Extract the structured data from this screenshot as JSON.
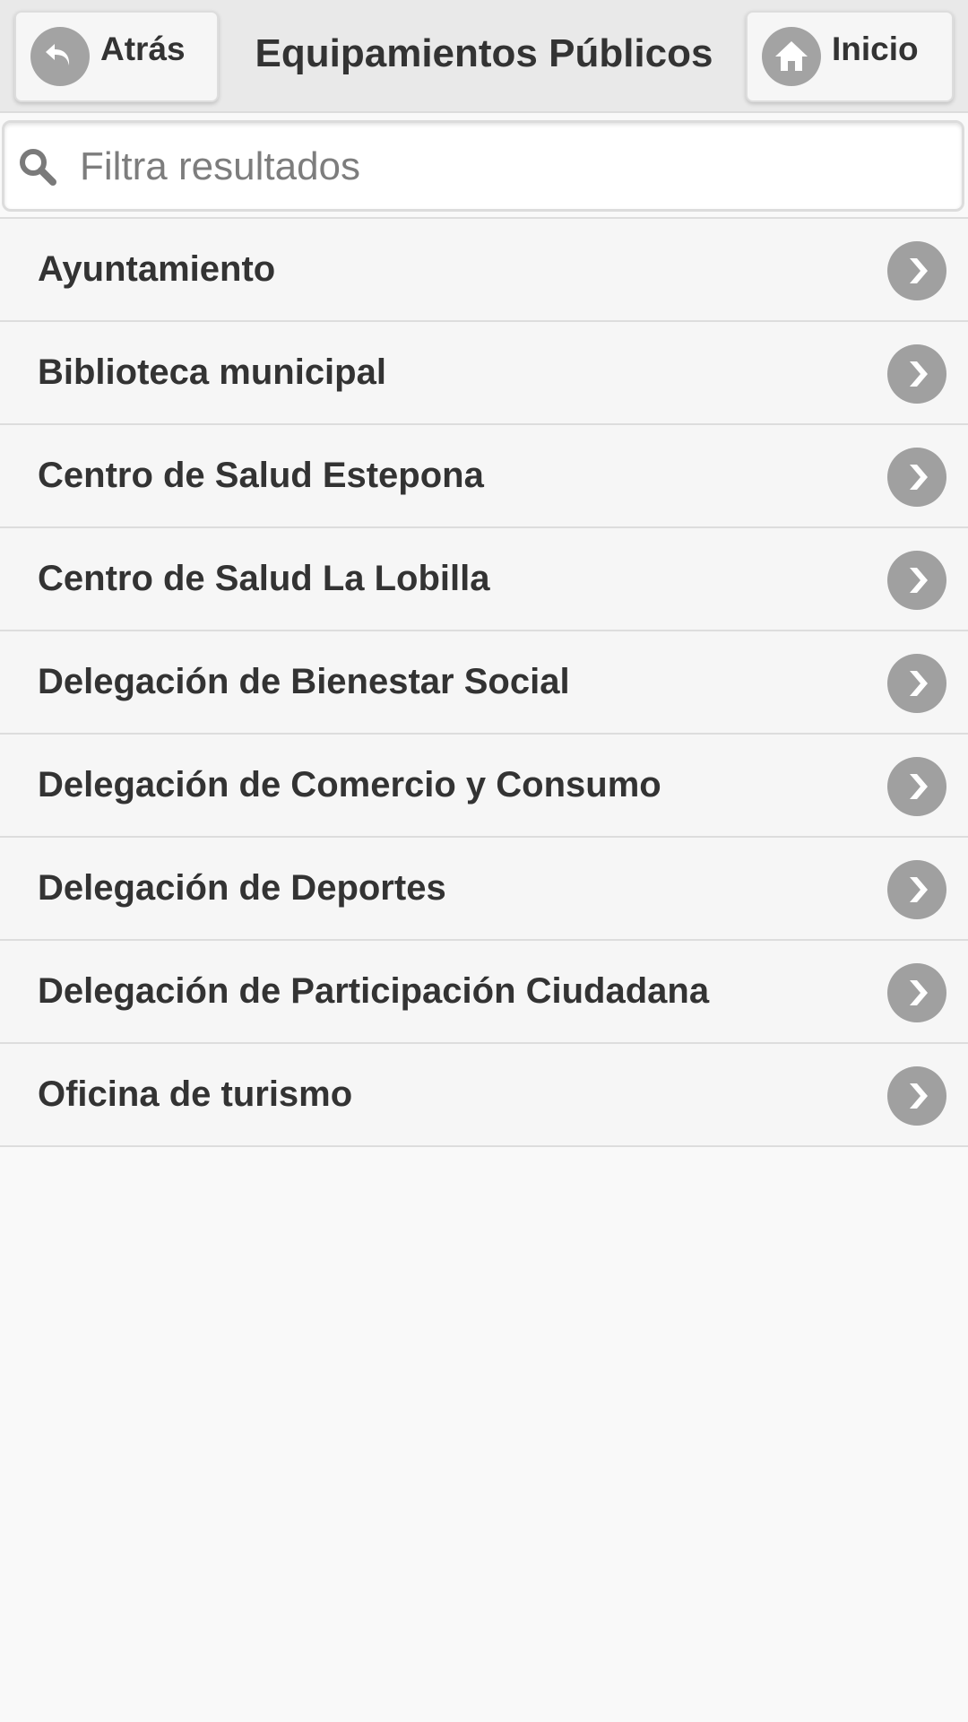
{
  "header": {
    "back_label": "Atrás",
    "title": "Equipamientos Públicos",
    "home_label": "Inicio",
    "back_icon": "back-arrow-icon",
    "home_icon": "home-icon"
  },
  "search": {
    "placeholder": "Filtra resultados",
    "value": ""
  },
  "list": {
    "items": [
      {
        "label": "Ayuntamiento"
      },
      {
        "label": "Biblioteca municipal"
      },
      {
        "label": "Centro de Salud Estepona"
      },
      {
        "label": "Centro de Salud La Lobilla"
      },
      {
        "label": "Delegación de Bienestar Social"
      },
      {
        "label": "Delegación de Comercio y Consumo"
      },
      {
        "label": "Delegación de Deportes"
      },
      {
        "label": "Delegación de Participación Ciudadana"
      },
      {
        "label": "Oficina de turismo"
      }
    ]
  },
  "colors": {
    "header_bg": "#e9e9e9",
    "icon_bg": "#a3a3a3",
    "text": "#333333",
    "list_bg": "#f6f6f6"
  }
}
